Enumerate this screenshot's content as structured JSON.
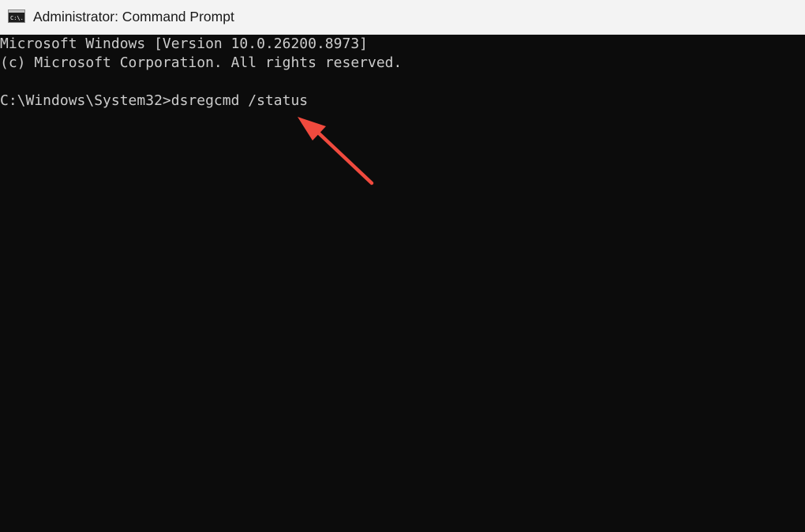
{
  "window": {
    "title": "Administrator: Command Prompt",
    "app_icon": "command-prompt-icon",
    "app_icon_text": "C:\\."
  },
  "console": {
    "lines": [
      "Microsoft Windows [Version 10.0.26200.8973]",
      "(c) Microsoft Corporation. All rights reserved.",
      "C:\\Windows\\System32>dsregcmd /status"
    ]
  },
  "annotation": {
    "arrow_color": "#f04a3e",
    "arrow_icon": "red-arrow-annotation"
  },
  "colors": {
    "titlebar_bg": "#f3f3f3",
    "console_bg": "#0c0c0c",
    "console_text": "#cccccc"
  }
}
